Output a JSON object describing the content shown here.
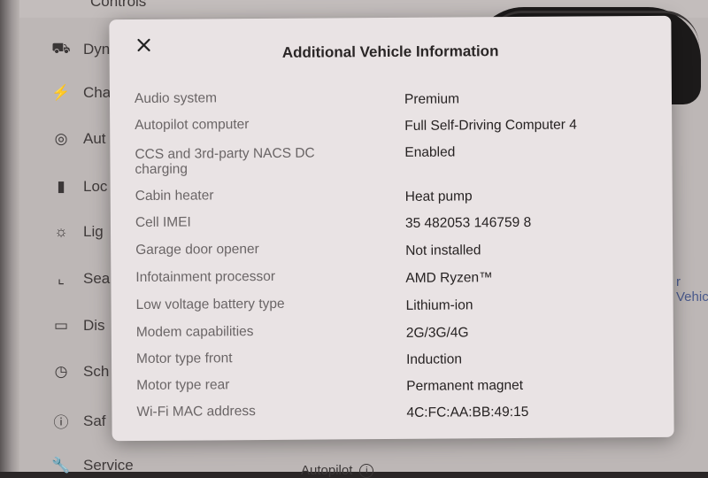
{
  "background": {
    "menu": [
      {
        "label": "Controls",
        "icon": "car-icon"
      },
      {
        "label": "Dyn",
        "icon": "car-dynamics-icon"
      },
      {
        "label": "Cha",
        "icon": "lightning-bolt-icon"
      },
      {
        "label": "Aut",
        "icon": "steering-wheel-icon"
      },
      {
        "label": "Loc",
        "icon": "lock-icon"
      },
      {
        "label": "Lig",
        "icon": "sun-icon"
      },
      {
        "label": "Sea",
        "icon": "seat-icon"
      },
      {
        "label": "Dis",
        "icon": "display-icon"
      },
      {
        "label": "Sch",
        "icon": "alarm-clock-icon"
      },
      {
        "label": "Saf",
        "icon": "info-circle-icon"
      },
      {
        "label": "Service",
        "icon": "wrench-icon"
      }
    ],
    "right_link": "r Vehic",
    "bottom_label": "Autopilot"
  },
  "modal": {
    "title": "Additional Vehicle Information",
    "close_icon": "close-icon",
    "rows": [
      {
        "label": "Audio system",
        "value": "Premium"
      },
      {
        "label": "Autopilot computer",
        "value": "Full Self-Driving Computer 4"
      },
      {
        "label": "CCS and 3rd-party NACS DC charging",
        "value": "Enabled"
      },
      {
        "label": "Cabin heater",
        "value": "Heat pump"
      },
      {
        "label": "Cell IMEI",
        "value": "35 482053 146759 8"
      },
      {
        "label": "Garage door opener",
        "value": "Not installed"
      },
      {
        "label": "Infotainment processor",
        "value": "AMD Ryzen™"
      },
      {
        "label": "Low voltage battery type",
        "value": "Lithium-ion"
      },
      {
        "label": "Modem capabilities",
        "value": "2G/3G/4G"
      },
      {
        "label": "Motor type front",
        "value": "Induction"
      },
      {
        "label": "Motor type rear",
        "value": "Permanent magnet"
      },
      {
        "label": "Wi-Fi MAC address",
        "value": "4C:FC:AA:BB:49:15"
      }
    ]
  }
}
